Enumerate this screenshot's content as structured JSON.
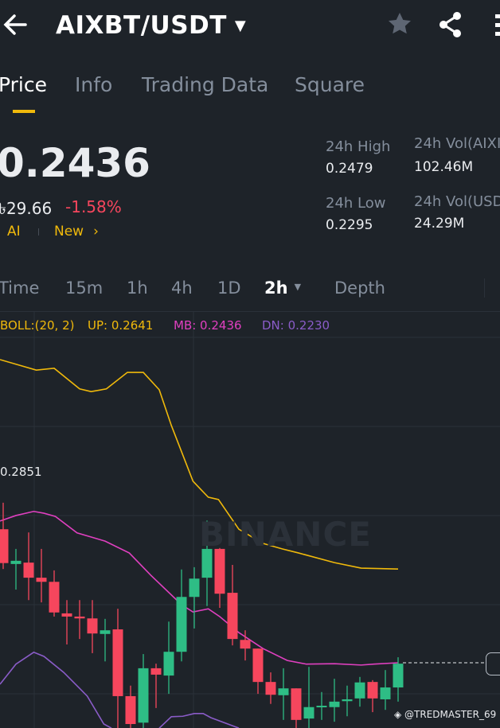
{
  "header": {
    "title": "AIXBT/USDT",
    "back_icon": "arrow-left-icon",
    "star_icon": "star-icon",
    "share_icon": "share-icon"
  },
  "tabs": [
    {
      "label": "Price",
      "active": true
    },
    {
      "label": "Info"
    },
    {
      "label": "Trading Data"
    },
    {
      "label": "Square"
    }
  ],
  "ticker": {
    "last_price": "0.2436",
    "local_price": "৳29.66",
    "change": "-1.58%",
    "tag1": "AI",
    "tag2": "New",
    "high_label": "24h High",
    "high": "0.2479",
    "low_label": "24h Low",
    "low": "0.2295",
    "vol_base_label": "24h Vol(AIXI",
    "vol_base": "102.46M",
    "vol_quote_label": "24h Vol(USD",
    "vol_quote": "24.29M"
  },
  "timeframes": [
    "Time",
    "15m",
    "1h",
    "4h",
    "1D",
    "2h",
    "Depth"
  ],
  "active_timeframe": "2h",
  "indicator": {
    "name": "BOLL:(20, 2)",
    "up": "UP: 0.2641",
    "mb": "MB: 0.2436",
    "dn": "DN: 0.2230"
  },
  "colors": {
    "up": "#2ebd85",
    "down": "#f6465d",
    "boll_up": "#f0b90b",
    "boll_mb": "#e040c0",
    "boll_dn": "#8a5cc8",
    "accent": "#f0b90b"
  },
  "chart": {
    "max_label": "0.2851",
    "watermark": "BINANCE",
    "credit": "@TREDMASTER_69"
  },
  "chart_data": {
    "type": "candlestick",
    "candles": [
      [
        0.2728,
        0.2654,
        0.2786,
        0.2641
      ],
      [
        0.2652,
        0.2659,
        0.2685,
        0.2596
      ],
      [
        0.2655,
        0.2622,
        0.2721,
        0.2573
      ],
      [
        0.2622,
        0.2613,
        0.2685,
        0.2568
      ],
      [
        0.2613,
        0.2546,
        0.2638,
        0.2537
      ],
      [
        0.2544,
        0.2537,
        0.2573,
        0.2476
      ],
      [
        0.2537,
        0.2533,
        0.2573,
        0.2488
      ],
      [
        0.2533,
        0.25,
        0.2573,
        0.2457
      ],
      [
        0.2499,
        0.2507,
        0.2532,
        0.2439
      ],
      [
        0.2509,
        0.2363,
        0.2554,
        0.2293
      ],
      [
        0.2363,
        0.2302,
        0.2386,
        0.2293
      ],
      [
        0.2305,
        0.2424,
        0.2455,
        0.2293
      ],
      [
        0.2424,
        0.241,
        0.2434,
        0.2337
      ],
      [
        0.2408,
        0.246,
        0.2526,
        0.2368
      ],
      [
        0.246,
        0.258,
        0.264,
        0.2439
      ],
      [
        0.258,
        0.262,
        0.2645,
        0.2511
      ],
      [
        0.2622,
        0.2685,
        0.2747,
        0.256
      ],
      [
        0.2685,
        0.2587,
        0.2687,
        0.2556
      ],
      [
        0.2589,
        0.2488,
        0.265,
        0.2474
      ],
      [
        0.2486,
        0.2467,
        0.2507,
        0.2441
      ],
      [
        0.2467,
        0.2394,
        0.2467,
        0.2368
      ],
      [
        0.2394,
        0.2366,
        0.2415,
        0.2346
      ],
      [
        0.2365,
        0.238,
        0.2424,
        0.2311
      ],
      [
        0.238,
        0.2311,
        0.238,
        0.2293
      ],
      [
        0.2314,
        0.2339,
        0.2427,
        0.2293
      ],
      [
        0.2339,
        0.2342,
        0.2372,
        0.2311
      ],
      [
        0.2339,
        0.2351,
        0.2401,
        0.2307
      ],
      [
        0.2352,
        0.2356,
        0.2386,
        0.2319
      ],
      [
        0.2358,
        0.2393,
        0.2405,
        0.234
      ],
      [
        0.2394,
        0.2358,
        0.2398,
        0.2328
      ],
      [
        0.2356,
        0.2382,
        0.242,
        0.2333
      ],
      [
        0.2382,
        0.2434,
        0.2448,
        0.2351
      ]
    ],
    "boll_up": [
      [
        0.75,
        0.3099
      ],
      [
        3.6,
        0.3076
      ],
      [
        5,
        0.308
      ],
      [
        7,
        0.3035
      ],
      [
        7.9,
        0.3029
      ],
      [
        9.1,
        0.3035
      ],
      [
        10.75,
        0.3071
      ],
      [
        12,
        0.3071
      ],
      [
        13.25,
        0.3033
      ],
      [
        14.2,
        0.2955
      ],
      [
        15.9,
        0.2833
      ],
      [
        17.1,
        0.2798
      ],
      [
        17.9,
        0.2793
      ],
      [
        19.5,
        0.2728
      ],
      [
        21.4,
        0.2697
      ],
      [
        22.9,
        0.2685
      ],
      [
        24.2,
        0.2676
      ],
      [
        27,
        0.2655
      ],
      [
        29.1,
        0.2643
      ],
      [
        32,
        0.2641
      ]
    ],
    "boll_mb": [
      [
        0.75,
        0.2746
      ],
      [
        2,
        0.2758
      ],
      [
        3.4,
        0.2767
      ],
      [
        4.2,
        0.2763
      ],
      [
        5.1,
        0.2756
      ],
      [
        6.8,
        0.272
      ],
      [
        9,
        0.2702
      ],
      [
        10.9,
        0.2676
      ],
      [
        12.6,
        0.2627
      ],
      [
        15,
        0.2563
      ],
      [
        15.9,
        0.2547
      ],
      [
        17.1,
        0.2554
      ],
      [
        18,
        0.2537
      ],
      [
        19.5,
        0.2502
      ],
      [
        21.4,
        0.2467
      ],
      [
        23.3,
        0.2441
      ],
      [
        24.8,
        0.2433
      ],
      [
        27,
        0.2434
      ],
      [
        29.1,
        0.2431
      ],
      [
        30.1,
        0.2433
      ],
      [
        32,
        0.2436
      ]
    ],
    "boll_dn": [
      [
        [
          0.75,
          0.2389
        ],
        [
          2,
          0.2433
        ],
        [
          3.4,
          0.2459
        ],
        [
          4.2,
          0.245
        ],
        [
          5.75,
          0.2415
        ],
        [
          7,
          0.238
        ],
        [
          7.6,
          0.2363
        ],
        [
          8.9,
          0.2302
        ],
        [
          9.5,
          0.2293
        ]
      ],
      [
        [
          13.25,
          0.2293
        ],
        [
          14.2,
          0.2318
        ],
        [
          15.1,
          0.2319
        ],
        [
          16,
          0.2325
        ],
        [
          16.7,
          0.2325
        ],
        [
          17.3,
          0.2316
        ],
        [
          19.5,
          0.2293
        ]
      ]
    ],
    "last_price": 0.2436
  }
}
